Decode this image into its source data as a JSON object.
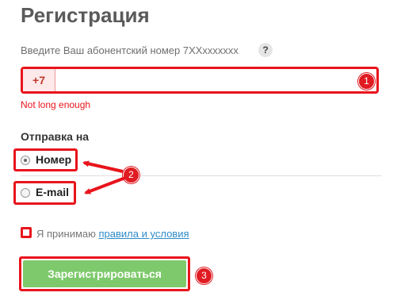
{
  "page": {
    "title": "Регистрация"
  },
  "phone": {
    "hint": "Введите Ваш абонентский номер 7XXxxxxxxx",
    "help_symbol": "?",
    "prefix": "+7",
    "value": "",
    "error": "Not long enough"
  },
  "send": {
    "label": "Отправка на",
    "options": [
      {
        "label": "Номер",
        "selected": true
      },
      {
        "label": "E-mail",
        "selected": false
      }
    ]
  },
  "agreement": {
    "text": "Я принимаю",
    "link": "правила и условия",
    "checked": false
  },
  "submit": {
    "label": "Зарегистрироваться"
  },
  "annotations": {
    "badges": [
      "1",
      "2",
      "3"
    ],
    "color": "#e8141c"
  },
  "colors": {
    "accent": "#e8141c",
    "button": "#7dc96b",
    "link": "#2e8bc9"
  }
}
